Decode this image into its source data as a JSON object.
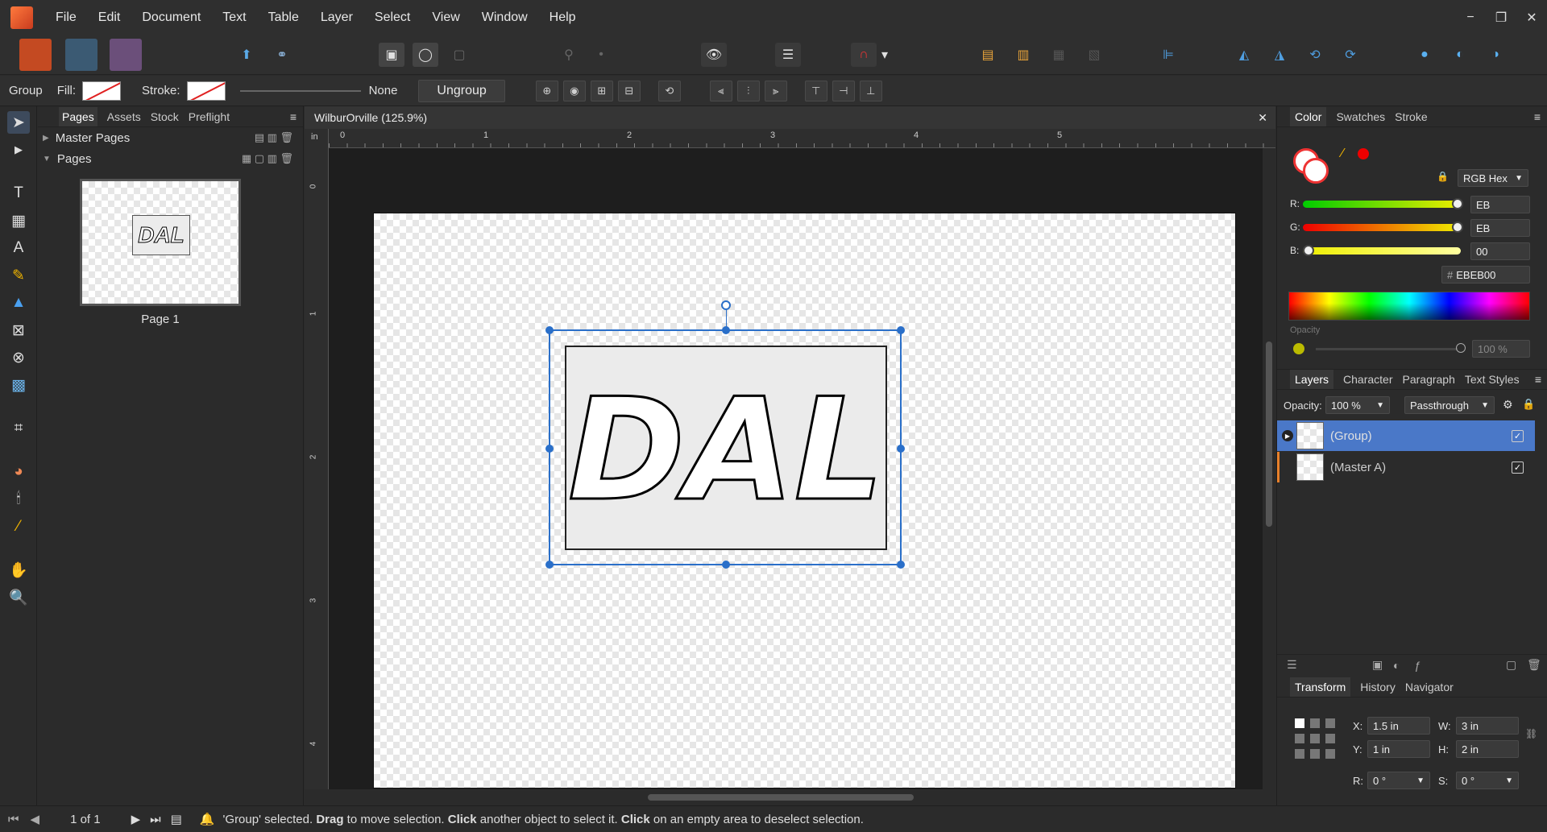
{
  "menu": [
    "File",
    "Edit",
    "Document",
    "Text",
    "Table",
    "Layer",
    "Select",
    "View",
    "Window",
    "Help"
  ],
  "window_controls": {
    "minimize": "−",
    "restore": "❐",
    "close": "✕"
  },
  "context": {
    "selection_type": "Group",
    "fill_label": "Fill:",
    "stroke_label": "Stroke:",
    "stroke_value": "None",
    "ungroup_label": "Ungroup"
  },
  "pages_panel": {
    "tabs": [
      "Pages",
      "Assets",
      "Stock",
      "Preflight"
    ],
    "master_pages": "Master Pages",
    "pages": "Pages",
    "page1": "Page 1",
    "thumb_text": "DAL"
  },
  "document": {
    "title": "WilburOrville (125.9%)",
    "ruler_unit": "in",
    "h_ticks": [
      "0",
      "1",
      "2",
      "3",
      "4",
      "5"
    ],
    "v_ticks": [
      "0",
      "1",
      "2",
      "3",
      "4"
    ],
    "logo_text": "DAL"
  },
  "color_panel": {
    "tabs": [
      "Color",
      "Swatches",
      "Stroke"
    ],
    "mode": "RGB Hex",
    "r_label": "R:",
    "r_value": "EB",
    "g_label": "G:",
    "g_value": "EB",
    "b_label": "B:",
    "b_value": "00",
    "hex": "EBEB00",
    "opacity_label": "Opacity",
    "opacity_value": "100 %",
    "colors": {
      "r": "#eb0000",
      "g": "#00eb00",
      "b": "#ebeb00",
      "accent": "#ebeb00"
    }
  },
  "layers_panel": {
    "tabs": [
      "Layers",
      "Character",
      "Paragraph",
      "Text Styles"
    ],
    "opacity_label": "Opacity:",
    "opacity_value": "100 %",
    "blend_mode": "Passthrough",
    "layers": [
      {
        "name": "(Group)",
        "visible_mark": "✓"
      },
      {
        "name": "(Master A)",
        "visible_mark": "✓"
      }
    ]
  },
  "transform_panel": {
    "tabs": [
      "Transform",
      "History",
      "Navigator"
    ],
    "x_label": "X:",
    "x_value": "1.5 in",
    "y_label": "Y:",
    "y_value": "1 in",
    "w_label": "W:",
    "w_value": "3 in",
    "h_label": "H:",
    "h_value": "2 in",
    "r_label": "R:",
    "r_value": "0 °",
    "s_label": "S:",
    "s_value": "0 °"
  },
  "status": {
    "page_indicator": "1 of 1",
    "message_1": "'Group' selected. ",
    "bold_drag": "Drag",
    "message_2": " to move selection. ",
    "bold_click": "Click",
    "message_3": " another object to select it. ",
    "bold_click2": "Click",
    "message_4": " on an empty area to deselect selection."
  }
}
